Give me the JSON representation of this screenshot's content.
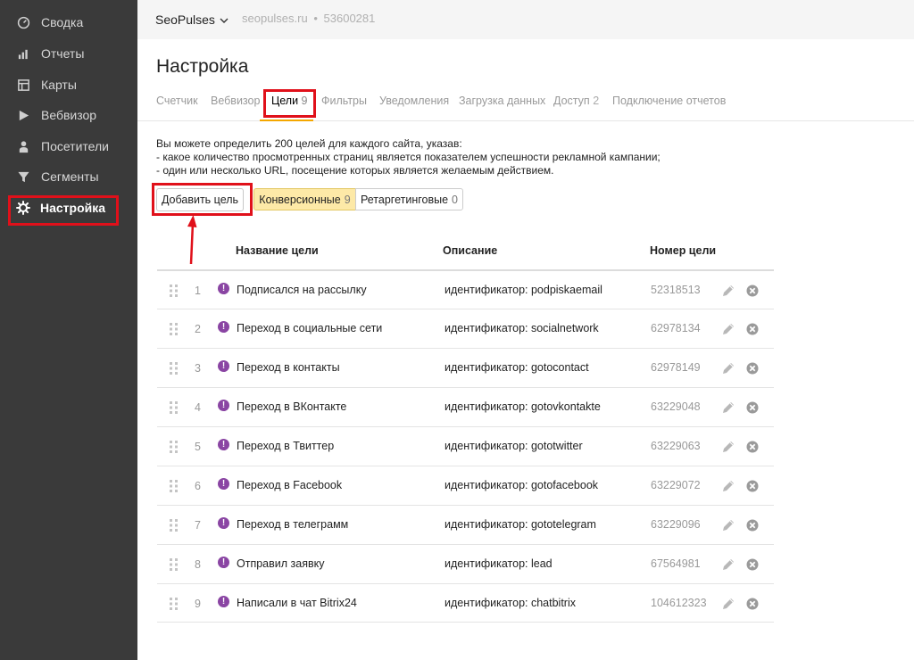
{
  "sidebar": {
    "items": [
      {
        "label": "Сводка",
        "icon": "gauge-icon"
      },
      {
        "label": "Отчеты",
        "icon": "bar-chart-icon"
      },
      {
        "label": "Карты",
        "icon": "map-icon"
      },
      {
        "label": "Вебвизор",
        "icon": "play-icon"
      },
      {
        "label": "Посетители",
        "icon": "person-icon"
      },
      {
        "label": "Сегменты",
        "icon": "funnel-icon"
      },
      {
        "label": "Настройка",
        "icon": "gear-icon",
        "active": true
      }
    ]
  },
  "header": {
    "brand": "SeoPulses",
    "site": "seopulses.ru",
    "site_separator": "•",
    "counter_id": "53600281"
  },
  "page": {
    "title": "Настройка",
    "tabs": [
      {
        "label": "Счетчик"
      },
      {
        "label": "Вебвизор"
      },
      {
        "label": "Цели",
        "count": "9",
        "active": true
      },
      {
        "label": "Фильтры"
      },
      {
        "label": "Уведомления"
      },
      {
        "label": "Загрузка данных"
      },
      {
        "label": "Доступ",
        "count": "2"
      },
      {
        "label": "Подключение отчетов"
      }
    ],
    "info": [
      "Вы можете определить 200 целей для каждого сайта, указав:",
      "- какое количество просмотренных страниц является показателем успешности рекламной кампании;",
      "- один или несколько URL, посещение которых является желаемым действием."
    ],
    "add_button": "Добавить цель",
    "filters": {
      "conversion": {
        "label": "Конверсионные",
        "count": "9"
      },
      "retargeting": {
        "label": "Ретаргетинговые",
        "count": "0"
      }
    }
  },
  "table": {
    "headers": {
      "name": "Название цели",
      "description": "Описание",
      "id": "Номер цели"
    },
    "rows": [
      {
        "num": "1",
        "name": "Подписался на рассылку",
        "description": "идентификатор: podpiskaemail",
        "id": "52318513"
      },
      {
        "num": "2",
        "name": "Переход в социальные сети",
        "description": "идентификатор: socialnetwork",
        "id": "62978134"
      },
      {
        "num": "3",
        "name": "Переход в контакты",
        "description": "идентификатор: gotocontact",
        "id": "62978149"
      },
      {
        "num": "4",
        "name": "Переход в ВКонтакте",
        "description": "идентификатор: gotovkontakte",
        "id": "63229048"
      },
      {
        "num": "5",
        "name": "Переход в Твиттер",
        "description": "идентификатор: gototwitter",
        "id": "63229063"
      },
      {
        "num": "6",
        "name": "Переход в Facebook",
        "description": "идентификатор: gotofacebook",
        "id": "63229072"
      },
      {
        "num": "7",
        "name": "Переход в телеграмм",
        "description": "идентификатор: gototelegram",
        "id": "63229096"
      },
      {
        "num": "8",
        "name": "Отправил заявку",
        "description": "идентификатор: lead",
        "id": "67564981"
      },
      {
        "num": "9",
        "name": "Написали в чат Bitrix24",
        "description": "идентификатор: chatbitrix",
        "id": "104612323"
      }
    ]
  },
  "colors": {
    "sidebar_bg": "#3a3a3a",
    "accent_tab": "#f4a700",
    "highlight": "#e0101a",
    "goal_icon": "#8a45a3",
    "filter_active": "#fde9a7"
  }
}
